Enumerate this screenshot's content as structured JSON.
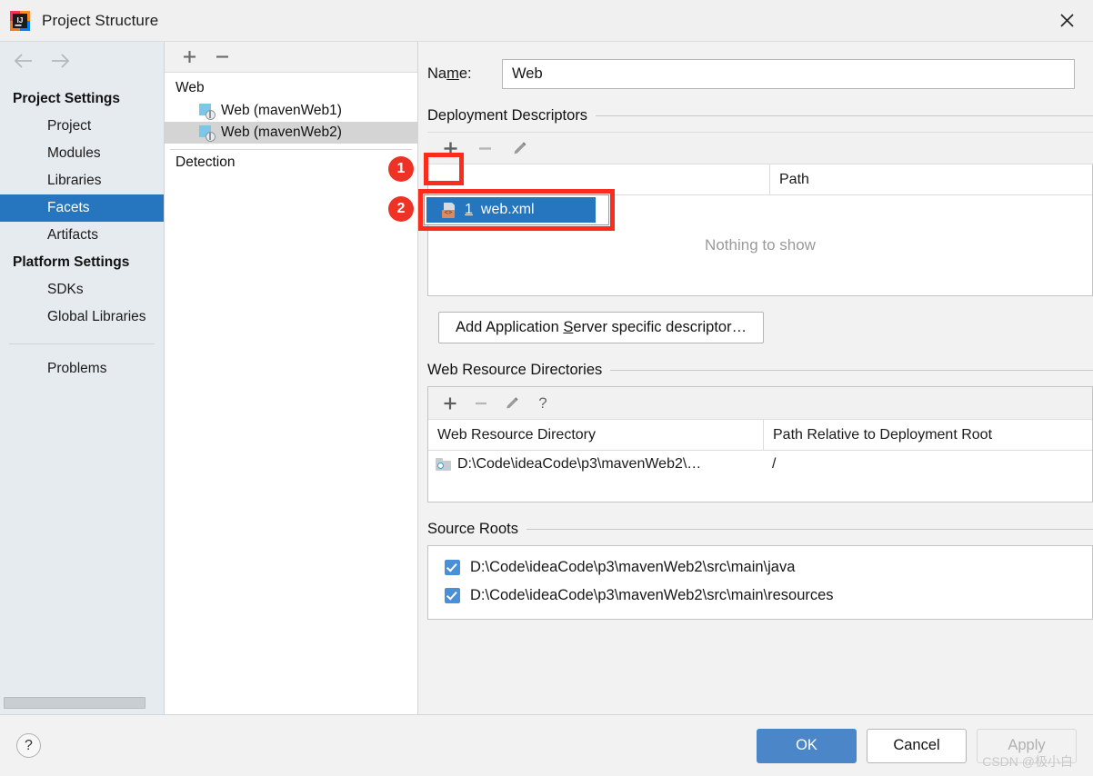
{
  "window": {
    "title": "Project Structure",
    "app_icon": "intellij-idea-logo",
    "close_icon": "close-icon"
  },
  "sidebar": {
    "back_icon": "arrow-left-icon",
    "forward_icon": "arrow-right-icon",
    "groups": [
      {
        "label": "Project Settings",
        "items": [
          {
            "label": "Project",
            "selected": false
          },
          {
            "label": "Modules",
            "selected": false
          },
          {
            "label": "Libraries",
            "selected": false
          },
          {
            "label": "Facets",
            "selected": true
          },
          {
            "label": "Artifacts",
            "selected": false
          }
        ]
      },
      {
        "label": "Platform Settings",
        "items": [
          {
            "label": "SDKs",
            "selected": false
          },
          {
            "label": "Global Libraries",
            "selected": false
          }
        ]
      }
    ],
    "extra_items": [
      {
        "label": "Problems",
        "selected": false
      }
    ]
  },
  "tree": {
    "toolbar": {
      "add": "+",
      "remove": "−"
    },
    "root_label": "Web",
    "children": [
      {
        "label": "Web (mavenWeb1)",
        "selected": false,
        "icon": "web-facet-icon"
      },
      {
        "label": "Web (mavenWeb2)",
        "selected": true,
        "icon": "web-facet-icon"
      }
    ],
    "detection_label": "Detection"
  },
  "detail": {
    "name_label_pre": "Na",
    "name_label_mnemonic": "m",
    "name_label_post": "e:",
    "name_value": "Web",
    "deployment_descriptors": {
      "title": "Deployment Descriptors",
      "toolbar": {
        "add": "+",
        "remove": "−",
        "edit": "edit-icon"
      },
      "columns": [
        "",
        "Path"
      ],
      "empty_text": "Nothing to show",
      "add_app_server_pre": "Add Application ",
      "add_app_server_mnemonic": "S",
      "add_app_server_post": "erver specific descriptor…"
    },
    "web_resource_directories": {
      "title": "Web Resource Directories",
      "toolbar": {
        "add": "+",
        "remove": "−",
        "edit": "edit-icon",
        "help": "?"
      },
      "columns": [
        "Web Resource Directory",
        "Path Relative to Deployment Root"
      ],
      "rows": [
        {
          "directory": "D:\\Code\\ideaCode\\p3\\mavenWeb2\\…",
          "relative_path": "/"
        }
      ]
    },
    "source_roots": {
      "title": "Source Roots",
      "rows": [
        {
          "path": "D:\\Code\\ideaCode\\p3\\mavenWeb2\\src\\main\\java",
          "checked": true
        },
        {
          "path": "D:\\Code\\ideaCode\\p3\\mavenWeb2\\src\\main\\resources",
          "checked": true
        }
      ]
    }
  },
  "popup": {
    "mnemonic": "1",
    "label": "web.xml",
    "icon": "xml-file-icon"
  },
  "annotations": {
    "badges": [
      {
        "number": "1"
      },
      {
        "number": "2"
      }
    ],
    "highlight_color": "#fb2b1e",
    "badge_color": "#ee3326"
  },
  "footer": {
    "help": "?",
    "ok": "OK",
    "cancel": "Cancel",
    "apply": "Apply"
  },
  "watermark": "CSDN @极小白",
  "colors": {
    "accent_blue": "#2675bf",
    "primary_button": "#4a86c8",
    "sidebar_bg": "#e6ebef",
    "panel_bg": "#f2f2f2",
    "annotation_red": "#fb2b1e"
  }
}
